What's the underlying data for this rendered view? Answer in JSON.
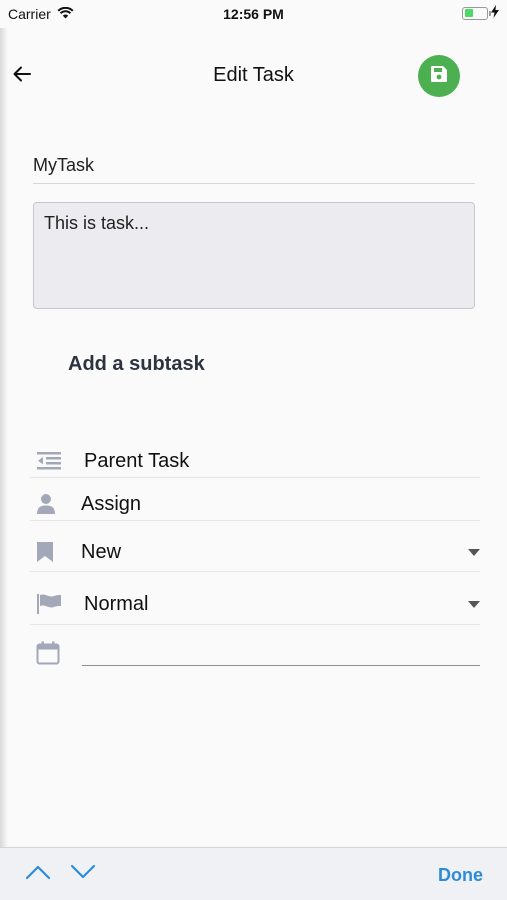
{
  "status_bar": {
    "carrier": "Carrier",
    "time": "12:56 PM"
  },
  "header": {
    "title": "Edit Task",
    "save_color": "#4caf50"
  },
  "form": {
    "name_value": "MyTask",
    "description_value": "This is task...",
    "add_subtask_label": "Add a subtask"
  },
  "rows": {
    "parent_task": "Parent Task",
    "assign": "Assign",
    "status": "New",
    "priority": "Normal",
    "due_date": ""
  },
  "icons": {
    "back": "arrow-left-icon",
    "save": "floppy-disk-icon",
    "parent": "outdent-list-icon",
    "assign": "user-icon",
    "status": "bookmark-icon",
    "priority": "flag-icon",
    "date": "calendar-icon"
  },
  "toolbar": {
    "done_label": "Done",
    "accent_color": "#2d8cd9"
  }
}
